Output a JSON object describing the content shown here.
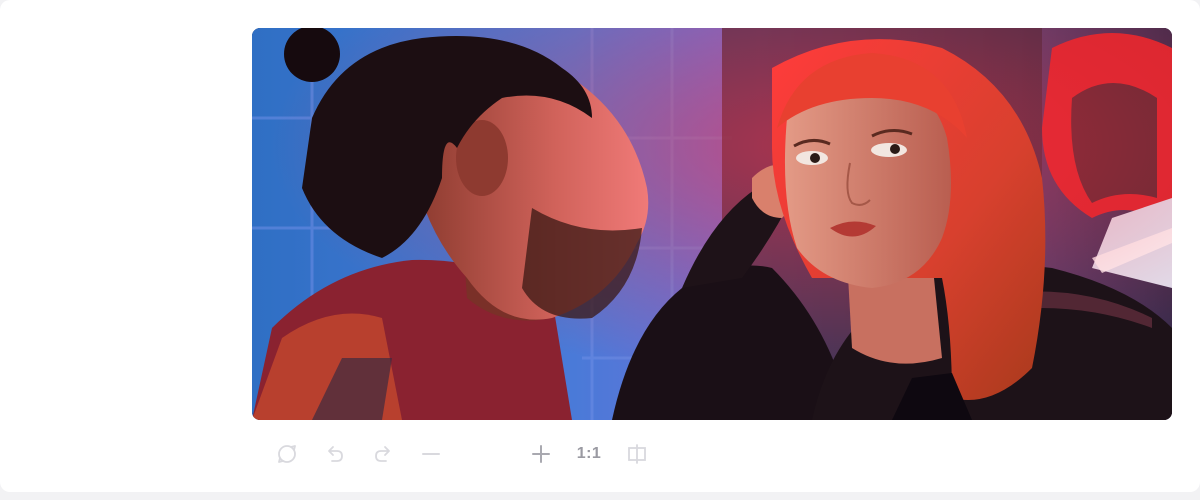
{
  "viewer": {
    "image": {
      "subject_icon": "photo-two-people-neon-light",
      "colors": {
        "wall_blue": "#3a72c8",
        "neon_red": "#e0202e",
        "shadow": "#170a1e"
      }
    },
    "toolbar": {
      "buttons": [
        {
          "name": "reset-icon",
          "state": "disabled"
        },
        {
          "name": "undo-icon",
          "state": "disabled"
        },
        {
          "name": "redo-icon",
          "state": "disabled"
        },
        {
          "name": "zoom-out-icon",
          "state": "disabled"
        },
        {
          "name": "zoom-in-icon",
          "state": "enabled"
        },
        {
          "name": "fit-original-icon",
          "state": "enabled"
        },
        {
          "name": "compare-icon",
          "state": "disabled"
        }
      ],
      "zoom_value": "",
      "ratio_label": "1:1"
    }
  }
}
